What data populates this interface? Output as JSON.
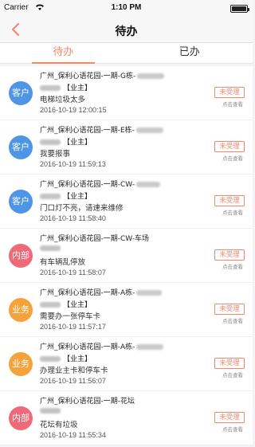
{
  "status_bar": {
    "carrier": "Carrier",
    "time": "1:10 PM"
  },
  "nav": {
    "title": "待办"
  },
  "tabs": [
    {
      "label": "待办",
      "active": true
    },
    {
      "label": "已办",
      "active": false
    }
  ],
  "colors": {
    "accent": "#f08a6e",
    "customer": "#4f95e6",
    "internal": "#ef6a78",
    "business": "#f5a23a"
  },
  "items": [
    {
      "badge": "客户",
      "type": "kh",
      "location": "广州_保利心语花园-一期-G栋-",
      "role": "【业主】",
      "description": "电梯垃圾太多",
      "date": "2016-10-19 12:00:15",
      "status": "未受理",
      "hint": "点击查看"
    },
    {
      "badge": "客户",
      "type": "kh",
      "location": "广州_保利心语花园-一期-E栋-",
      "role": "【业主】",
      "description": "我要报事",
      "date": "2016-10-19 11:59:13",
      "status": "未受理",
      "hint": "点击查看"
    },
    {
      "badge": "客户",
      "type": "kh",
      "location": "广州_保利心语花园-一期-CW-",
      "role": "【业主】",
      "description": "门口灯不亮，请速来维修",
      "date": "2016-10-19 11:58:40",
      "status": "未受理",
      "hint": "点击查看"
    },
    {
      "badge": "内部",
      "type": "nb",
      "location": "广州_保利心语花园-一期-CW-车场",
      "role": "",
      "description": "有车辆乱停放",
      "date": "2016-10-19 11:58:07",
      "status": "未受理",
      "hint": "点击查看"
    },
    {
      "badge": "业务",
      "type": "yw",
      "location": "广州_保利心语花园-一期-A栋-",
      "role": "【业主】",
      "description": "需要办一张停车卡",
      "date": "2016-10-19 11:57:17",
      "status": "未受理",
      "hint": "点击查看"
    },
    {
      "badge": "业务",
      "type": "yw",
      "location": "广州_保利心语花园-一期-A栋-",
      "role": "【业主】",
      "description": "办理业主卡和停车卡",
      "date": "2016-10-19 11:56:07",
      "status": "未受理",
      "hint": "点击查看"
    },
    {
      "badge": "内部",
      "type": "nb",
      "location": "广州_保利心语花园-一期-花坛",
      "role": "",
      "description": "花坛有垃圾",
      "date": "2016-10-19 11:55:34",
      "status": "未受理",
      "hint": "点击查看"
    }
  ]
}
